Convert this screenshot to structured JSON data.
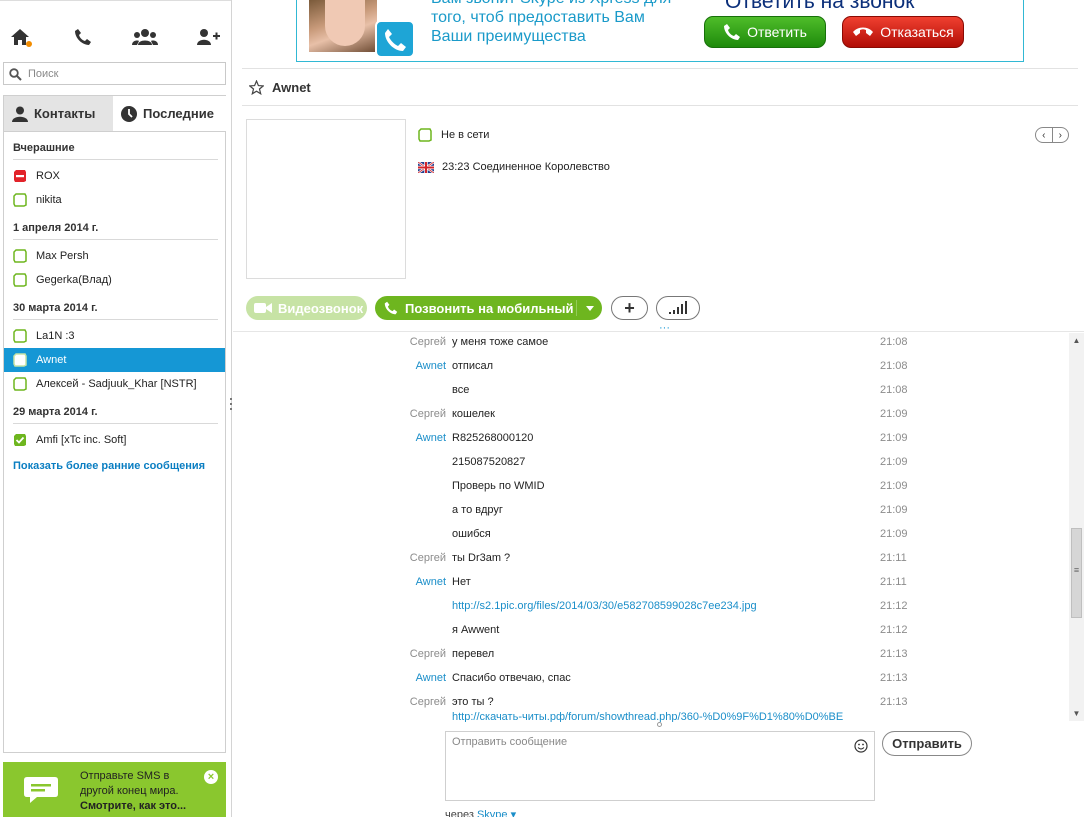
{
  "nav": {
    "icons": [
      "home-icon",
      "phone-icon",
      "contacts-group-icon",
      "add-contact-icon"
    ]
  },
  "search": {
    "placeholder": "Поиск"
  },
  "tabs": {
    "contacts": "Контакты",
    "recent": "Последние"
  },
  "recent": {
    "groups": [
      {
        "label": "Вчерашние"
      },
      {
        "label": "1 апреля 2014 г."
      },
      {
        "label": "30 марта 2014 г."
      },
      {
        "label": "29 марта 2014 г."
      }
    ],
    "items": [
      {
        "name": "ROX",
        "status": "blocked"
      },
      {
        "name": "nikita",
        "status": "offline"
      },
      {
        "name": "Max Persh",
        "status": "offline"
      },
      {
        "name": "Gegerka(Влад)",
        "status": "offline"
      },
      {
        "name": "La1N :3",
        "status": "offline"
      },
      {
        "name": "Awnet",
        "status": "offline"
      },
      {
        "name": "Алексей - Sadjuuk_Khar [NSTR]",
        "status": "offline"
      },
      {
        "name": "Amfi [xTc inc. Soft]",
        "status": "online"
      }
    ],
    "show_more": "Показать более ранние сообщения"
  },
  "sms_promo": {
    "line1": "Отправьте SMS в",
    "line2": "другой конец мира.",
    "link": "Смотрите, как это..."
  },
  "ad": {
    "text_line1": "Вам звонит Skype из Xpress для",
    "text_line2": "того, чтоб предоставить Вам",
    "text_line3": "Ваши преимущества",
    "title": "Ответить на звонок",
    "answer": "Ответить",
    "decline": "Отказаться"
  },
  "contact": {
    "name": "Awnet",
    "status": "Не в сети",
    "local_time": "23:23 Соединенное Королевство"
  },
  "actions": {
    "video": "Видеозвонок",
    "call_mobile": "Позвонить на мобильный",
    "plus": "+"
  },
  "messages": [
    {
      "from": "Сергей",
      "me": false,
      "text": "у меня тоже самое",
      "time": "21:08"
    },
    {
      "from": "Awnet",
      "me": true,
      "text": "отписал",
      "time": "21:08"
    },
    {
      "from": "",
      "me": true,
      "text": "все",
      "time": "21:08"
    },
    {
      "from": "Сергей",
      "me": false,
      "text": "кошелек",
      "time": "21:09"
    },
    {
      "from": "Awnet",
      "me": true,
      "text": "R825268000120",
      "time": "21:09"
    },
    {
      "from": "",
      "me": true,
      "text": "215087520827",
      "time": "21:09"
    },
    {
      "from": "",
      "me": true,
      "text": "Проверь по WMID",
      "time": "21:09"
    },
    {
      "from": "",
      "me": true,
      "text": "а то вдруг",
      "time": "21:09"
    },
    {
      "from": "",
      "me": true,
      "text": "ошибся",
      "time": "21:09"
    },
    {
      "from": "Сергей",
      "me": false,
      "text": "ты Dr3am ?",
      "time": "21:11"
    },
    {
      "from": "Awnet",
      "me": true,
      "text": "Нет",
      "time": "21:11"
    },
    {
      "from": "",
      "me": true,
      "text": "http://s2.1pic.org/files/2014/03/30/e582708599028c7ee234.jpg",
      "time": "21:12",
      "link": true
    },
    {
      "from": "",
      "me": true,
      "text": "я Awwent",
      "time": "21:12"
    },
    {
      "from": "Сергей",
      "me": false,
      "text": "перевел",
      "time": "21:13"
    },
    {
      "from": "Awnet",
      "me": true,
      "text": "Спасибо отвечаю, спас",
      "time": "21:13"
    },
    {
      "from": "Сергей",
      "me": false,
      "text": "это ты ?",
      "time": "21:13"
    },
    {
      "from": "",
      "me": false,
      "text": "http://скачать-читы.рф/forum/showthread.php/360-%D0%9F%D1%80%D0%BE",
      "time": "",
      "link": true
    }
  ],
  "composer": {
    "placeholder": "Отправить сообщение",
    "send": "Отправить",
    "via_prefix": "через",
    "via_service": "Skype"
  },
  "colors": {
    "accent": "#1597d5",
    "green": "#6eb61f",
    "selected": "#1597d5",
    "link": "#1a8ec9"
  }
}
